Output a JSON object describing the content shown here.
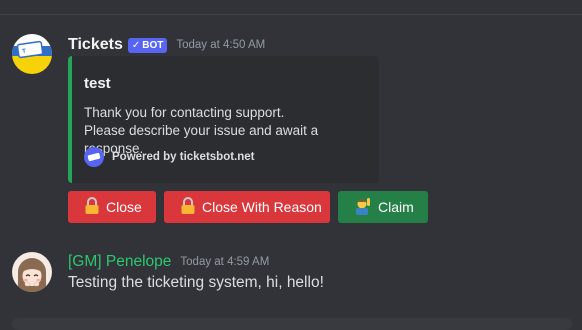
{
  "bot_message": {
    "username": "Tickets",
    "badge_label": "BOT",
    "timestamp": "Today at 4:50 AM",
    "embed": {
      "title": "test",
      "description_line1": "Thank you for contacting support.",
      "description_line2": "Please describe your issue and await a response.",
      "footer_text": "Powered by ticketsbot.net",
      "accent_color": "#23a55a"
    },
    "buttons": [
      {
        "label": "Close",
        "icon": "lock-icon",
        "color": "#da373c"
      },
      {
        "label": "Close With Reason",
        "icon": "lock-icon",
        "color": "#da373c"
      },
      {
        "label": "Claim",
        "icon": "person-raising-hand-icon",
        "color": "#248046"
      }
    ]
  },
  "user_message": {
    "username": "[GM] Penelope",
    "timestamp": "Today at 4:59 AM",
    "text": "Testing the ticketing system, hi, hello!",
    "name_color": "#2dc770"
  }
}
